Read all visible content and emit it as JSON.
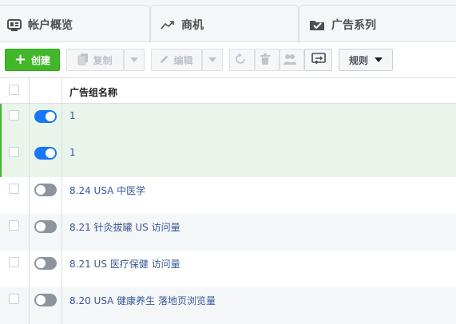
{
  "tabs": [
    {
      "label": "帐户概览",
      "icon": "account-overview-icon"
    },
    {
      "label": "商机",
      "icon": "trend-line-icon"
    },
    {
      "label": "广告系列",
      "icon": "folder-check-icon"
    }
  ],
  "toolbar": {
    "create_label": "创建",
    "copy_label": "复制",
    "edit_label": "编辑",
    "rules_label": "规则"
  },
  "table": {
    "column_header": "广告组名称",
    "rows": [
      {
        "name": "1",
        "status": "on",
        "selected": true
      },
      {
        "name": "1",
        "status": "on",
        "selected": true
      },
      {
        "name": "8.24 USA 中医学",
        "status": "off",
        "selected": false
      },
      {
        "name": "8.21 针灸拔罐 US 访问量",
        "status": "off",
        "selected": false
      },
      {
        "name": "8.21 US 医疗保健 访问量",
        "status": "off",
        "selected": false
      },
      {
        "name": "8.20 USA 健康养生 落地页浏览量",
        "status": "off",
        "selected": false
      }
    ]
  },
  "colors": {
    "create_green": "#42b72a",
    "toggle_on": "#1877f2",
    "link_blue": "#365899",
    "selected_row": "#e9f5ea"
  }
}
